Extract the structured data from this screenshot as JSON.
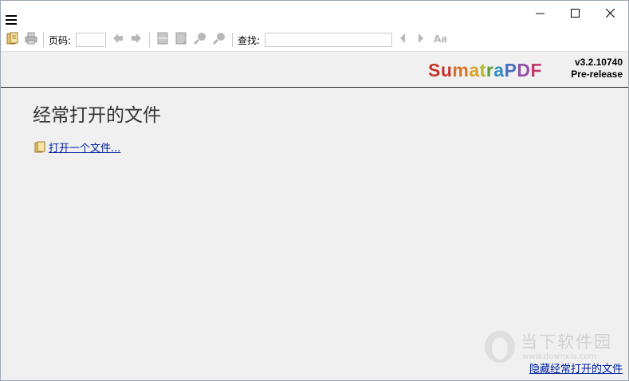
{
  "toolbar": {
    "page_label": "页码:",
    "page_value": "",
    "find_label": "查找:",
    "find_value": ""
  },
  "branding": {
    "logo_letters": [
      "S",
      "u",
      "m",
      "a",
      "t",
      "r",
      "a",
      "P",
      "D",
      "F"
    ],
    "logo_colors": [
      "#c2382e",
      "#c2382e",
      "#d4762b",
      "#d4a32b",
      "#b1b82c",
      "#5c9c32",
      "#2f8fbf",
      "#4a6fc0",
      "#9350a8",
      "#c13a6c"
    ],
    "version": "v3.2.10740",
    "build_type": "Pre-release"
  },
  "main": {
    "heading": "经常打开的文件",
    "open_file_link": "打开一个文件...",
    "hide_recent_link": "隐藏经常打开的文件"
  },
  "watermark": {
    "text": "当下软件园",
    "url": "www.downxia.com"
  },
  "colors": {
    "link": "#0020a0",
    "background": "#f0f0f0"
  }
}
